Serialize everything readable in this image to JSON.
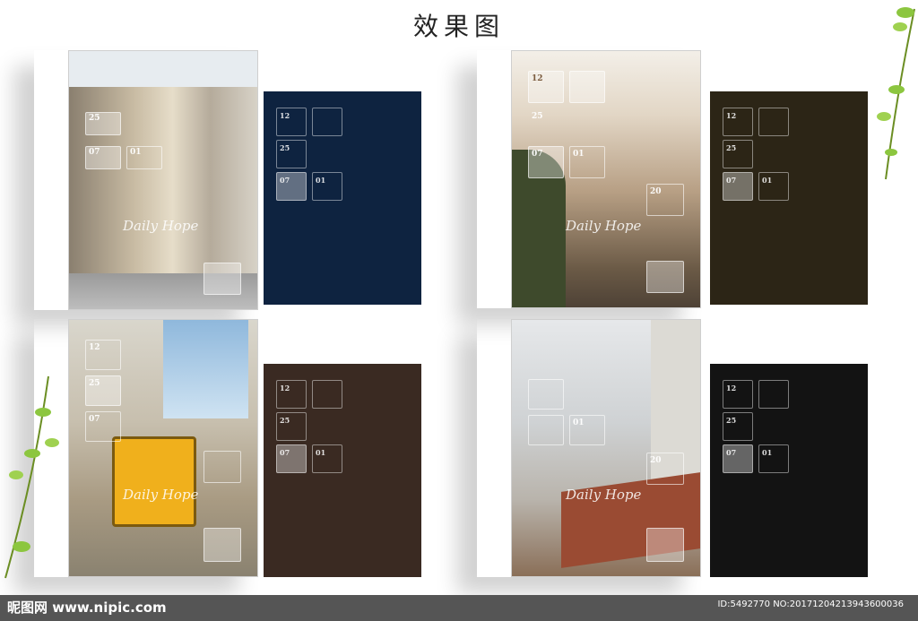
{
  "header": {
    "title": "效果图"
  },
  "covers": [
    {
      "label": "Daily Hope",
      "nums": [
        "25",
        "07",
        "01"
      ]
    },
    {
      "label": "Daily Hope",
      "nums": [
        "12",
        "25",
        "07",
        "01",
        "20"
      ]
    },
    {
      "label": "Daily Hope",
      "nums": [
        "12",
        "25",
        "07"
      ]
    },
    {
      "label": "Daily Hope",
      "nums": [
        "20",
        "01"
      ]
    }
  ],
  "backs": [
    {
      "color": "#0e2340",
      "nums": [
        "12",
        "25",
        "07",
        "01"
      ]
    },
    {
      "color": "#2c2516",
      "nums": [
        "12",
        "25",
        "07",
        "01"
      ]
    },
    {
      "color": "#3a2a22",
      "nums": [
        "12",
        "25",
        "07",
        "01"
      ]
    },
    {
      "color": "#131313",
      "nums": [
        "12",
        "25",
        "07",
        "01"
      ]
    }
  ],
  "footer": {
    "site": "昵图网 www.nipic.com",
    "id": "ID:5492770 NO:20171204213943600036"
  }
}
